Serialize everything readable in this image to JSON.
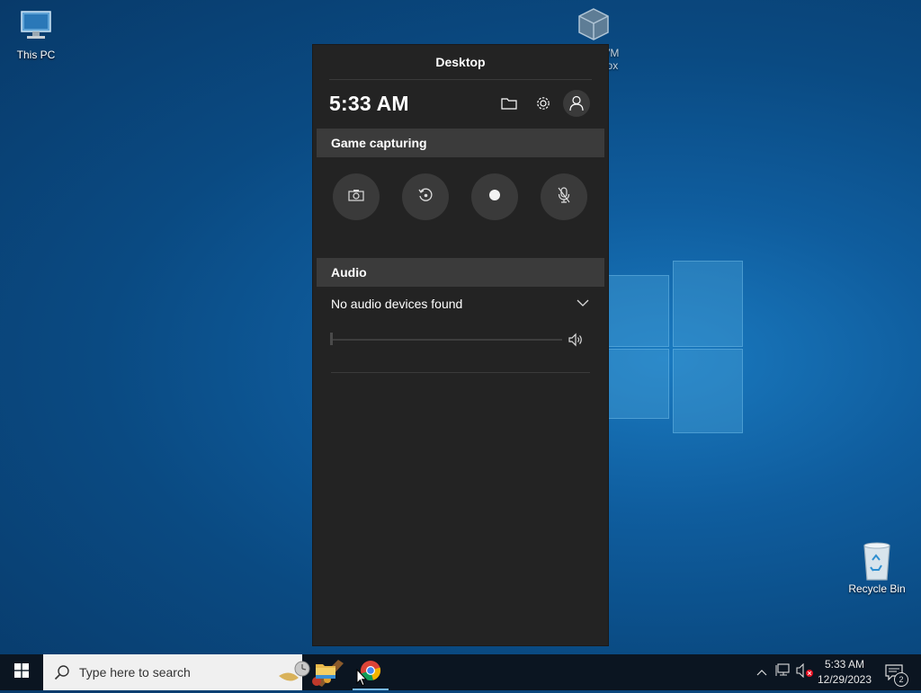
{
  "desktop": {
    "icons": [
      {
        "label": "This PC",
        "icon": "this-pc-icon"
      },
      {
        "label": "Oracle VM VirtualBox",
        "icon": "virtualbox-icon"
      },
      {
        "label": "Recycle Bin",
        "icon": "recycle-bin-icon"
      }
    ]
  },
  "game_bar": {
    "title": "Desktop",
    "time": "5:33 AM",
    "top_icons": [
      "folder-icon",
      "gear-icon",
      "person-icon"
    ],
    "capture_section": {
      "heading": "Game capturing",
      "buttons": [
        "camera-icon",
        "replay-icon",
        "record-dot-icon",
        "mic-off-icon"
      ]
    },
    "audio_section": {
      "heading": "Audio",
      "device": "No audio devices found",
      "volume": 0
    }
  },
  "taskbar": {
    "search_placeholder": "Type here to search",
    "apps": [
      "file-explorer-icon",
      "chrome-icon"
    ],
    "clock_time": "5:33 AM",
    "clock_date": "12/29/2023",
    "notification_count": "2"
  },
  "colors": {
    "panel_bg": "#232323",
    "section_bg": "#3b3b3b",
    "button_bg": "#3a3a3a",
    "taskbar_bg": "#0b1521",
    "accent": "#76b9ed"
  }
}
